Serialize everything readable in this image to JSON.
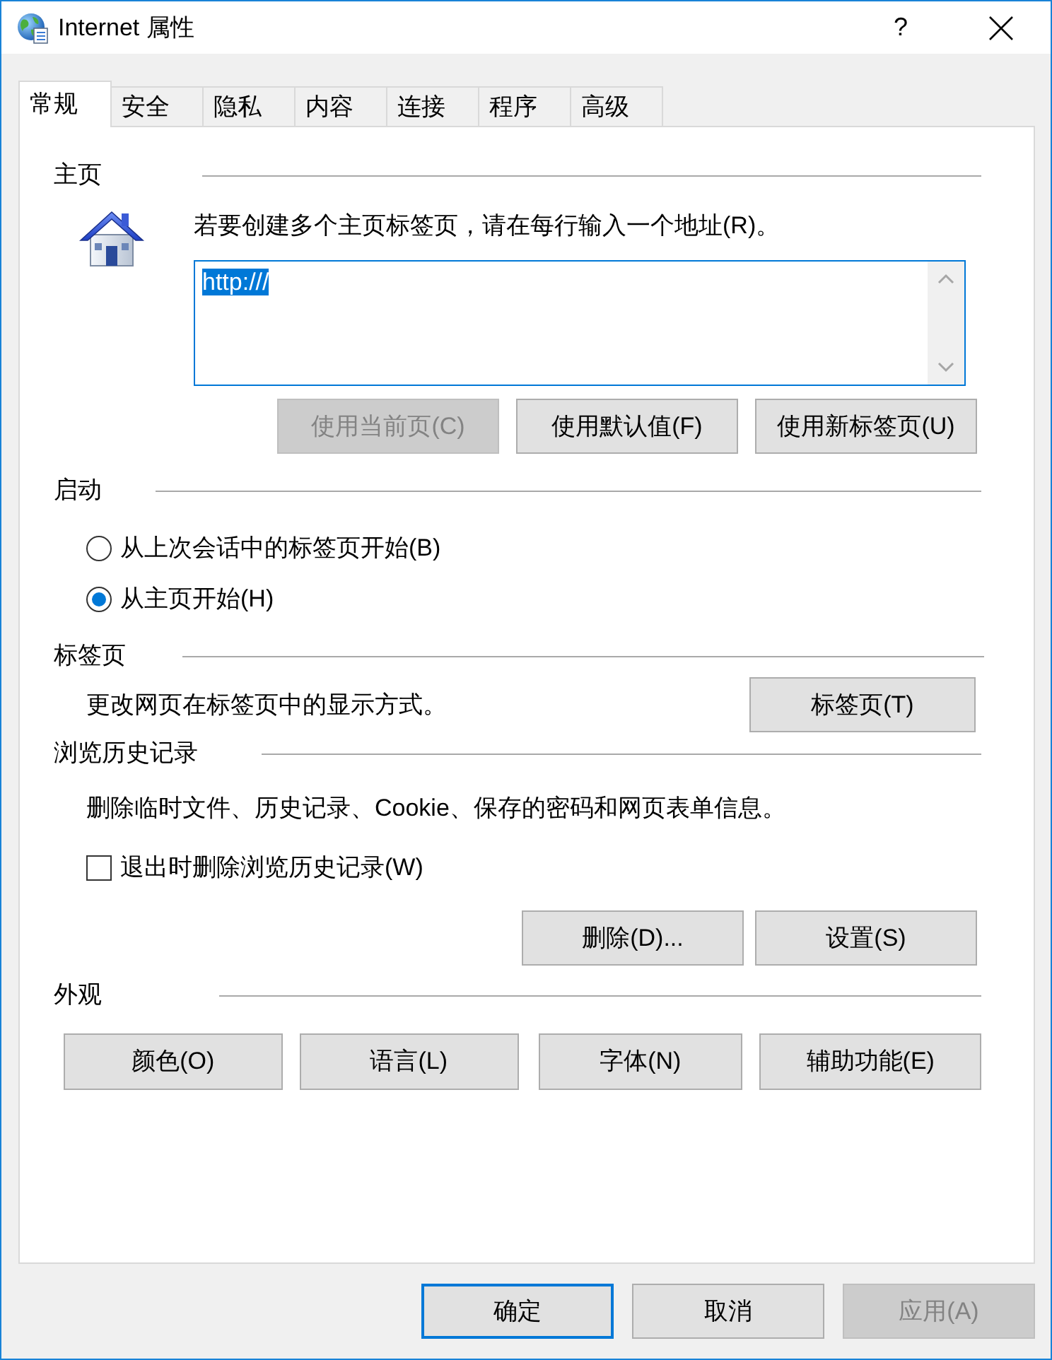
{
  "window": {
    "title": "Internet 属性",
    "help_label": "?"
  },
  "tabs": [
    {
      "label": "常规",
      "selected": true
    },
    {
      "label": "安全",
      "selected": false
    },
    {
      "label": "隐私",
      "selected": false
    },
    {
      "label": "内容",
      "selected": false
    },
    {
      "label": "连接",
      "selected": false
    },
    {
      "label": "程序",
      "selected": false
    },
    {
      "label": "高级",
      "selected": false
    }
  ],
  "homepage": {
    "heading": "主页",
    "instruction": "若要创建多个主页标签页，请在每行输入一个地址(R)。",
    "address": {
      "value": "http:///",
      "selected": true
    },
    "buttons": [
      {
        "label": "使用当前页(C)",
        "disabled": true
      },
      {
        "label": "使用默认值(F)",
        "disabled": false
      },
      {
        "label": "使用新标签页(U)",
        "disabled": false
      }
    ]
  },
  "startup": {
    "heading": "启动",
    "options": [
      {
        "label": "从上次会话中的标签页开始(B)",
        "selected": false
      },
      {
        "label": "从主页开始(H)",
        "selected": true
      }
    ]
  },
  "tab_settings": {
    "heading": "标签页",
    "description": "更改网页在标签页中的显示方式。",
    "button": {
      "label": "标签页(T)"
    }
  },
  "browsing_history": {
    "heading": "浏览历史记录",
    "description": "删除临时文件、历史记录、Cookie、保存的密码和网页表单信息。",
    "delete_on_exit": {
      "label": "退出时删除浏览历史记录(W)",
      "checked": false
    },
    "buttons": [
      {
        "label": "删除(D)..."
      },
      {
        "label": "设置(S)"
      }
    ]
  },
  "appearance": {
    "heading": "外观",
    "buttons": [
      {
        "label": "颜色(O)"
      },
      {
        "label": "语言(L)"
      },
      {
        "label": "字体(N)"
      },
      {
        "label": "辅助功能(E)"
      }
    ]
  },
  "dialog_buttons": [
    {
      "label": "确定",
      "default": true,
      "disabled": false
    },
    {
      "label": "取消",
      "default": false,
      "disabled": false
    },
    {
      "label": "应用(A)",
      "default": false,
      "disabled": true
    }
  ]
}
